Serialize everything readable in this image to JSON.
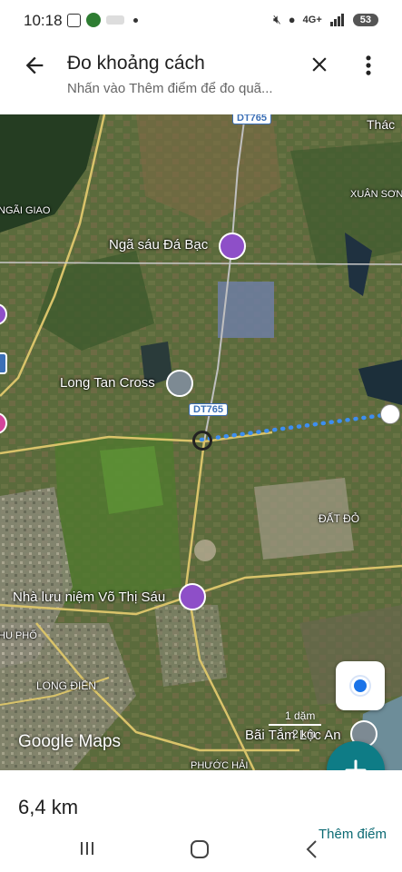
{
  "status_bar": {
    "time": "10:18",
    "network": "4G+",
    "battery": "53"
  },
  "header": {
    "title": "Đo khoảng cách",
    "subtitle": "Nhấn vào Thêm điểm để đo quã..."
  },
  "map": {
    "places": {
      "thac": "Thác",
      "xuan_son": "XUÂN SƠN",
      "ngai_giao": "NGÃI GIAO",
      "nga_sau": "Ngã sáu Đá Bạc",
      "long_tan": "Long Tan Cross",
      "dat_do": "ĐẤT ĐỎ",
      "nha_luu_niem": "Nhà lưu niệm Võ Thị Sáu",
      "hu_pho": "HU PHỐ",
      "long_dien": "LONG ĐIỀN",
      "bai_tam": "Bãi Tắm Lộc An",
      "phuoc_hai": "PHƯỚC HẢI"
    },
    "route_shields": [
      "DT765",
      "DT765"
    ],
    "scale_text": "1 dặm",
    "scale_text2": "2 km",
    "watermark": "Google Maps",
    "colors": {
      "measure_line": "#3d8ef0",
      "accent": "#0e7c86",
      "poi_purple": "#8e4fc8",
      "poi_gray": "#7d8a93"
    }
  },
  "bottom_panel": {
    "distance": "6,4 km",
    "add_point_label": "Thêm điểm"
  },
  "nav": {
    "icons": [
      "recent-apps-icon",
      "home-icon",
      "back-nav-icon"
    ]
  }
}
